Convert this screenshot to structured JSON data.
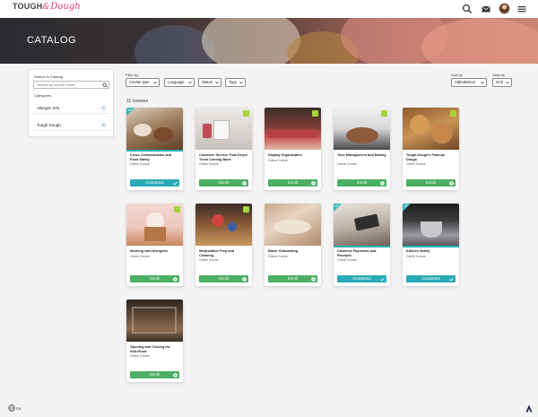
{
  "header": {
    "logo_part1": "TOUGH",
    "logo_amp": "&",
    "logo_part2": "Dough",
    "icons": [
      "search-icon",
      "mail-icon",
      "avatar",
      "hamburger-menu-icon"
    ]
  },
  "banner": {
    "title": "CATALOG"
  },
  "sidebar": {
    "search_label": "Search in Catalog",
    "search_placeholder": "Search by course name...",
    "categories_label": "Categories",
    "categories": [
      {
        "name": "Allergen Info",
        "count": "2"
      },
      {
        "name": "Tough Dough",
        "count": "9"
      }
    ]
  },
  "filters": {
    "filter_label": "Filter by",
    "course_type": "Course type",
    "language": "Language",
    "status": "Status",
    "tags": "Tags",
    "sort_label": "Sort by",
    "sort_value": "Alphabetical",
    "view_label": "View as",
    "view_value": "Grid"
  },
  "course_count": "11 courses",
  "courses": [
    {
      "title": "Cross Contamination and Food Safety",
      "type": "Online Course",
      "action": "Completed",
      "status": "completed"
    },
    {
      "title": "Customer Service That Keeps Them Coming Back",
      "type": "Online Course",
      "action": "Enroll",
      "status": "enroll"
    },
    {
      "title": "Display Organization",
      "type": "Online Course",
      "action": "Enroll",
      "status": "enroll"
    },
    {
      "title": "Time Management and Baking",
      "type": "Online Course",
      "action": "Enroll",
      "status": "enroll"
    },
    {
      "title": "Tough Dough's Famous Dough",
      "type": "Online Course",
      "action": "Enroll",
      "status": "enroll"
    },
    {
      "title": "Working with Allergens",
      "type": "Online Course",
      "action": "Enroll",
      "status": "enroll"
    },
    {
      "title": "Workstation Prep and Cleaning",
      "type": "Online Course",
      "action": "Enroll",
      "status": "enroll"
    },
    {
      "title": "Baker Onboarding",
      "type": "Online Course",
      "action": "Enroll",
      "status": "enroll"
    },
    {
      "title": "Cashless Payments and Receipts",
      "type": "Online Course",
      "action": "Completed",
      "status": "completed"
    },
    {
      "title": "Kitchen Safety",
      "type": "Online Course",
      "action": "Completed",
      "status": "completed"
    },
    {
      "title": "Opening and Closing the Storefront",
      "type": "Online Course",
      "action": "Enroll",
      "status": "enroll"
    }
  ],
  "footer": {
    "language": "EN"
  },
  "colors": {
    "enroll": "#4caf63",
    "completed": "#2aaab8",
    "accent": "#e8326f",
    "badge": "#a4d63a"
  }
}
